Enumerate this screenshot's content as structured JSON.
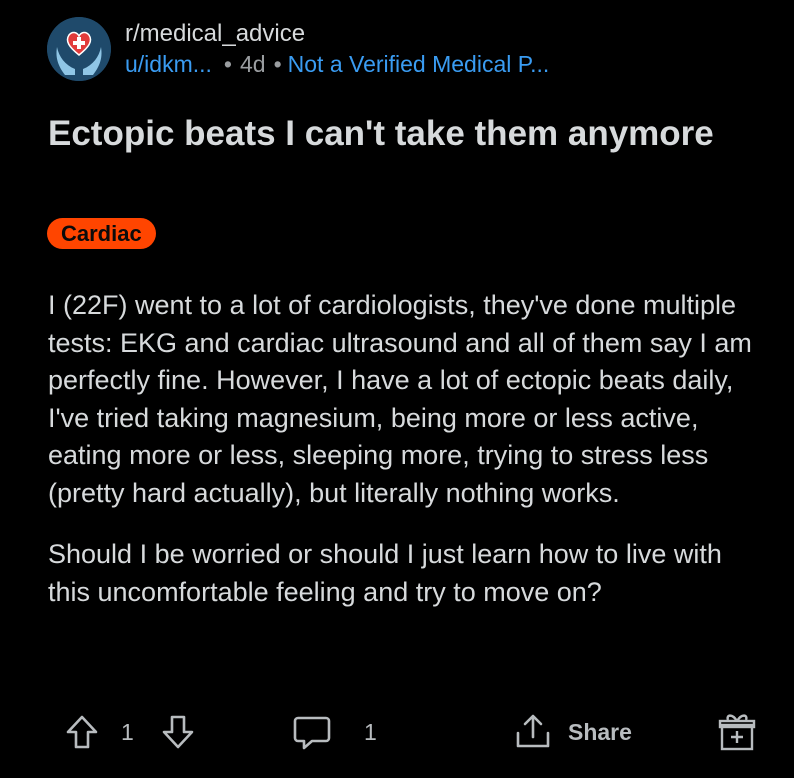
{
  "post": {
    "subreddit": "r/medical_advice",
    "username": "u/idkm...",
    "separator": "•",
    "age": "4d",
    "user_flair": "Not a Verified Medical P...",
    "title": "Ectopic beats I can't take them anymore",
    "flair": "Cardiac",
    "body": [
      "I (22F) went to a lot of cardiologists, they've done multiple tests: EKG and cardiac ultrasound and all of them say I am perfectly fine. However, I have a lot of ectopic beats daily, I've tried taking magnesium, being more or less active, eating more or less, sleeping more, trying to stress less (pretty hard actually), but literally nothing works.",
      "Should I be worried or should I just learn how to live with this uncomfortable feeling and try to move on?"
    ]
  },
  "actions": {
    "upvote_icon": "arrow-up-icon",
    "vote_count": "1",
    "downvote_icon": "arrow-down-icon",
    "comment_icon": "comment-bubble-icon",
    "comment_count": "1",
    "share_icon": "share-icon",
    "share_label": "Share",
    "award_icon": "gift-icon"
  },
  "colors": {
    "background": "#000000",
    "text": "#d7dadc",
    "link": "#3a9cf2",
    "flair_bg": "#ff4500",
    "muted": "#9a9da0"
  }
}
